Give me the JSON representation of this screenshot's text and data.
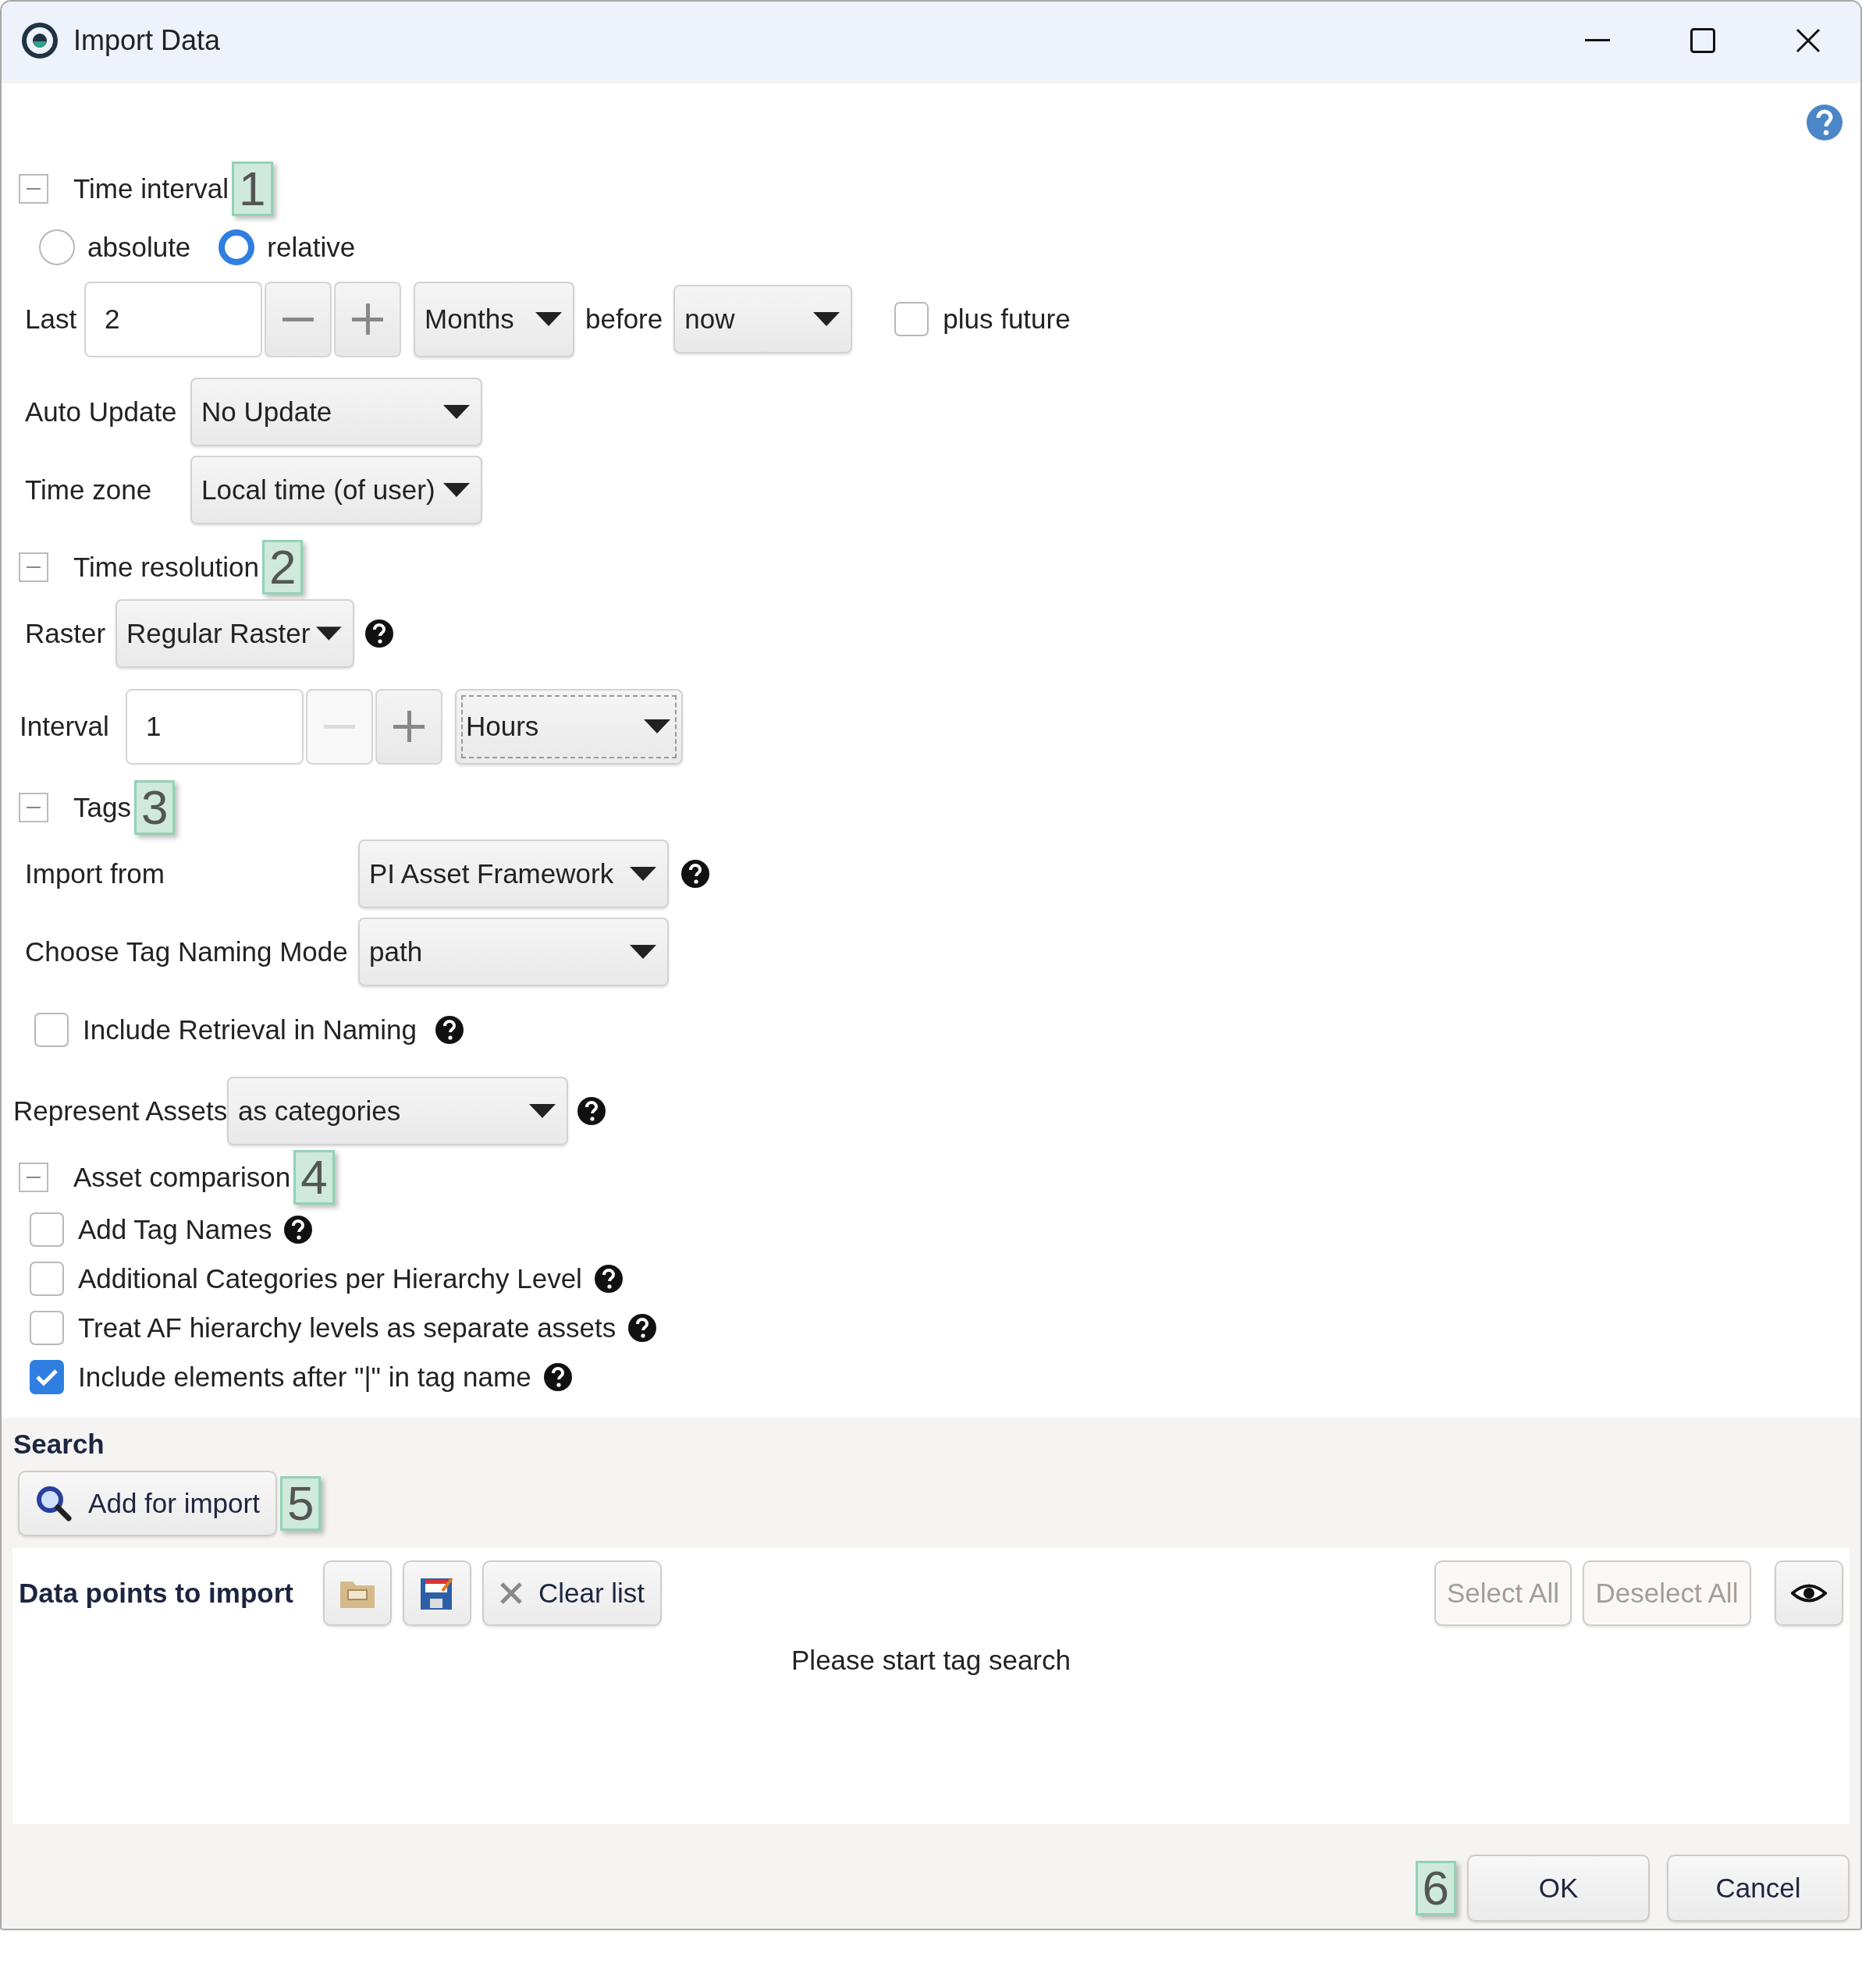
{
  "window": {
    "title": "Import Data"
  },
  "time_interval": {
    "title": "Time interval",
    "expanded": true,
    "callout": "1",
    "modes": [
      {
        "label": "absolute",
        "selected": false
      },
      {
        "label": "relative",
        "selected": true
      }
    ],
    "last": {
      "label": "Last",
      "value": "2",
      "decrement_disabled": false,
      "unit": "Months"
    },
    "before_label": "before",
    "anchor": "now",
    "plus_future": {
      "label": "plus future",
      "checked": false
    },
    "auto_update": {
      "label": "Auto Update",
      "value": "No Update"
    },
    "time_zone": {
      "label": "Time zone",
      "value": "Local time (of user)"
    }
  },
  "time_resolution": {
    "title": "Time resolution",
    "expanded": true,
    "callout": "2",
    "raster": {
      "label": "Raster",
      "value": "Regular Raster"
    },
    "interval": {
      "label": "Interval",
      "value": "1",
      "decrement_disabled": true,
      "unit": "Hours",
      "focused": true
    }
  },
  "tags": {
    "title": "Tags",
    "expanded": true,
    "callout": "3",
    "import_from": {
      "label": "Import from",
      "value": "PI Asset Framework"
    },
    "naming_mode": {
      "label": "Choose Tag Naming Mode",
      "value": "path"
    },
    "include_retrieval": {
      "label": "Include Retrieval in Naming",
      "checked": false
    },
    "represent_assets": {
      "label": "Represent Assets",
      "value": "as categories"
    }
  },
  "asset_comparison": {
    "title": "Asset comparison",
    "expanded": true,
    "callout": "4",
    "options": [
      {
        "label": "Add Tag Names",
        "checked": false
      },
      {
        "label": "Additional Categories per Hierarchy Level",
        "checked": false
      },
      {
        "label": "Treat AF hierarchy levels as separate assets",
        "checked": false
      },
      {
        "label": "Include elements after \"|\" in tag name",
        "checked": true
      }
    ]
  },
  "search": {
    "title": "Search",
    "button": "Add for import",
    "callout": "5"
  },
  "data_points": {
    "title": "Data points to import",
    "clear_button": "Clear list",
    "select_all": {
      "label": "Select All",
      "disabled": true
    },
    "deselect_all": {
      "label": "Deselect All",
      "disabled": true
    },
    "empty_message": "Please start tag search"
  },
  "footer": {
    "callout": "6",
    "buttons": [
      "OK",
      "Cancel"
    ]
  }
}
